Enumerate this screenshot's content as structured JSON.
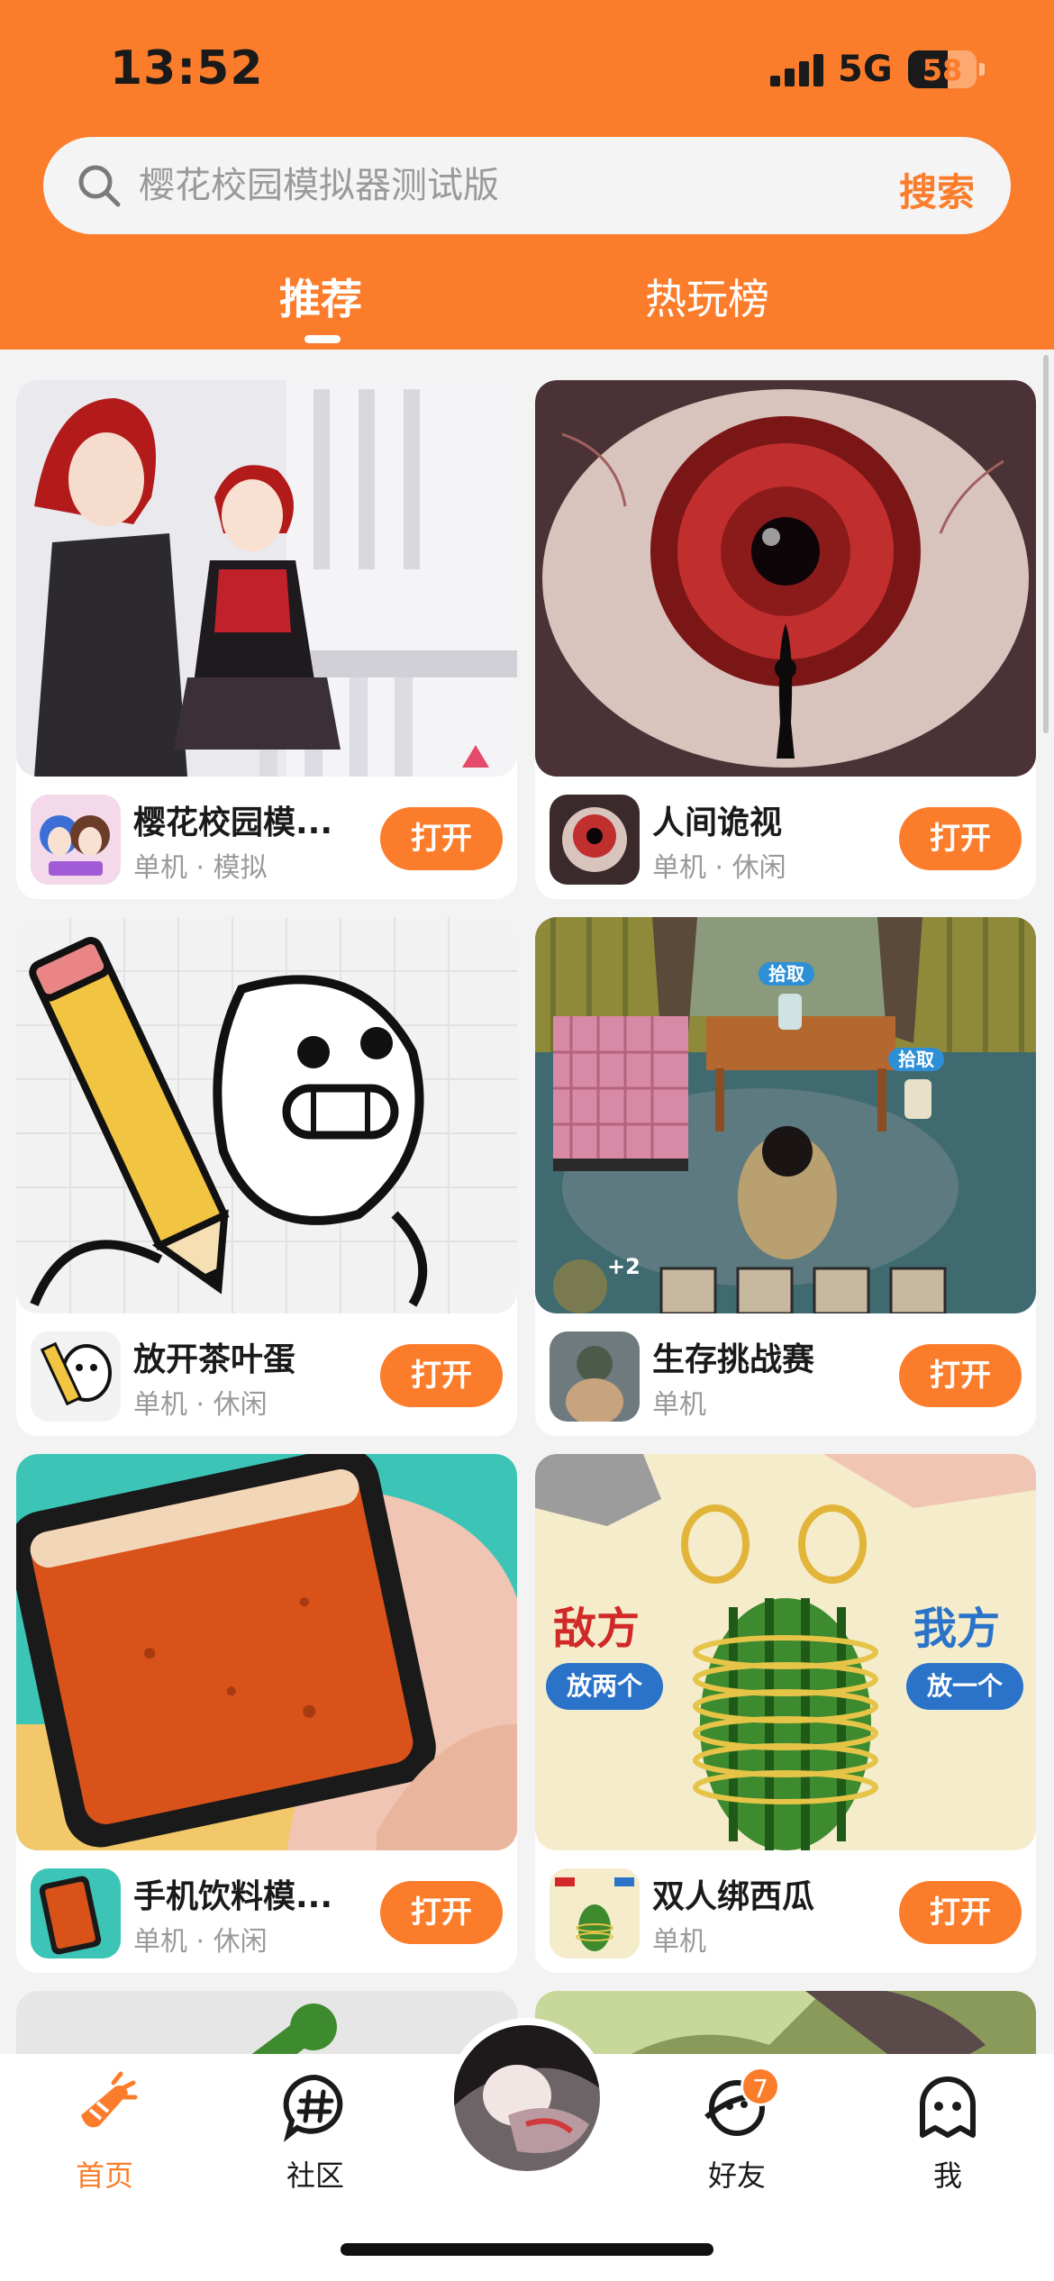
{
  "status_bar": {
    "time": "13:52",
    "network": "5G",
    "battery": "58"
  },
  "search": {
    "placeholder": "樱花校园模拟器测试版",
    "button_label": "搜索"
  },
  "tabs": [
    {
      "label": "推荐"
    },
    {
      "label": "热玩榜"
    }
  ],
  "cards": [
    {
      "name": "樱花校园模...",
      "tags": "单机 · 模拟",
      "button": "打开"
    },
    {
      "name": "人间诡视",
      "tags": "单机 · 休闲",
      "button": "打开"
    },
    {
      "name": "放开茶叶蛋",
      "tags": "单机 · 休闲",
      "button": "打开"
    },
    {
      "name": "生存挑战赛",
      "tags": "单机",
      "button": "打开"
    },
    {
      "name": "手机饮料模...",
      "tags": "单机 · 休闲",
      "button": "打开"
    },
    {
      "name": "双人绑西瓜",
      "tags": "单机",
      "button": "打开"
    }
  ],
  "thumb_text": {
    "pickup_1": "拾取",
    "pickup_2": "拾取",
    "plus": "+2",
    "enemy": "敌方",
    "us": "我方",
    "enemy_btn": "放两个",
    "us_btn": "放一个"
  },
  "nav": {
    "home": "首页",
    "community": "社区",
    "friends": "好友",
    "friends_badge": "7",
    "me": "我"
  },
  "colors": {
    "accent": "#fb7d2b",
    "background": "#f3f3f3"
  }
}
